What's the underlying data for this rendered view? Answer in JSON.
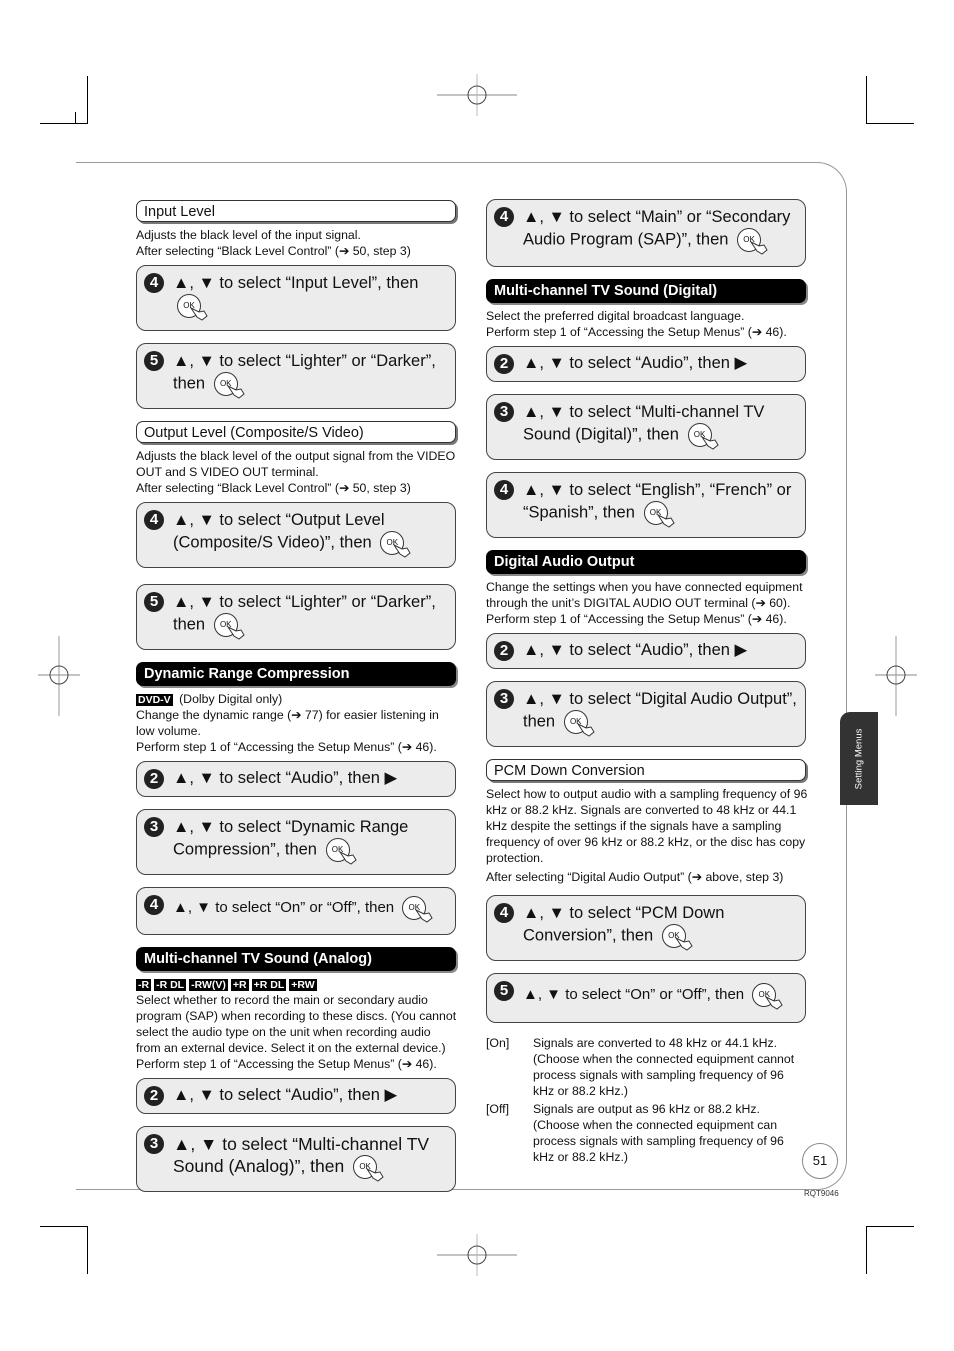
{
  "left_column": {
    "input_level": {
      "title": "Input Level",
      "desc": [
        "Adjusts the black level of the input signal.",
        "After selecting “Black Level Control” (➔ 50, step 3)"
      ],
      "steps": [
        {
          "num": "4",
          "text": "▲, ▼ to select “Input Level”, then"
        },
        {
          "num": "5",
          "text": "▲, ▼ to select “Lighter” or “Darker”, then"
        }
      ]
    },
    "output_level": {
      "title": "Output Level (Composite/S Video)",
      "desc": [
        "Adjusts the black level of the output signal from the VIDEO OUT and S VIDEO OUT terminal.",
        "After selecting “Black Level Control” (➔ 50, step 3)"
      ],
      "steps": [
        {
          "num": "4",
          "text": "▲, ▼ to select “Output Level (Composite/S Video)”, then"
        },
        {
          "num": "5",
          "text": "▲, ▼ to select “Lighter” or “Darker”, then"
        }
      ]
    },
    "drc": {
      "title": "Dynamic Range Compression",
      "badge": "DVD-V",
      "badge_note": " (Dolby Digital only)",
      "desc": [
        "Change the dynamic range (➔ 77) for easier listening in low volume.",
        "Perform step 1 of “Accessing the Setup Menus” (➔ 46)."
      ],
      "steps": [
        {
          "num": "2",
          "text": "▲, ▼ to select “Audio”, then ▶"
        },
        {
          "num": "3",
          "text": "▲, ▼ to select “Dynamic Range Compression”, then"
        },
        {
          "num": "4",
          "text": "▲, ▼ to select “On” or “Off”, then"
        }
      ]
    },
    "mts_analog": {
      "title": "Multi-channel TV Sound (Analog)",
      "badges": [
        "-R",
        "-R DL",
        "-RW(V)",
        "+R",
        "+R DL",
        "+RW"
      ],
      "desc": [
        "Select whether to record the main or secondary audio program (SAP) when recording to these discs. (You cannot select the audio type on the unit when recording audio from an external device. Select it on the external device.)",
        "Perform step 1 of “Accessing the Setup Menus” (➔ 46)."
      ],
      "steps": [
        {
          "num": "2",
          "text": "▲, ▼ to select “Audio”, then ▶"
        },
        {
          "num": "3",
          "text": "▲, ▼ to select “Multi-channel TV Sound (Analog)”, then"
        }
      ]
    }
  },
  "right_column": {
    "mts_analog_cont": {
      "steps": [
        {
          "num": "4",
          "text": "▲, ▼ to select “Main” or “Secondary Audio Program (SAP)”, then"
        }
      ]
    },
    "mts_digital": {
      "title": "Multi-channel TV Sound (Digital)",
      "desc": [
        "Select the preferred digital broadcast language.",
        "Perform step 1 of “Accessing the Setup Menus” (➔ 46)."
      ],
      "steps": [
        {
          "num": "2",
          "text": "▲, ▼ to select “Audio”, then ▶"
        },
        {
          "num": "3",
          "text": "▲, ▼ to select “Multi-channel TV Sound (Digital)”, then"
        },
        {
          "num": "4",
          "text": "▲, ▼ to select “English”, “French” or “Spanish”, then"
        }
      ]
    },
    "digital_audio_output": {
      "title": "Digital Audio Output",
      "desc": [
        "Change the settings when you have connected equipment through the unit’s DIGITAL AUDIO OUT terminal (➔ 60).",
        "Perform step 1 of “Accessing the Setup Menus” (➔ 46)."
      ],
      "steps": [
        {
          "num": "2",
          "text": "▲, ▼ to select “Audio”, then ▶"
        },
        {
          "num": "3",
          "text": "▲, ▼ to select “Digital Audio Output”, then"
        }
      ]
    },
    "pcm": {
      "title": "PCM Down Conversion",
      "desc": [
        "Select how to output audio with a sampling frequency of 96 kHz or 88.2 kHz. Signals are converted to 48 kHz or 44.1 kHz despite the settings if the signals have a sampling frequency of over 96 kHz or 88.2 kHz, or the disc has copy protection.",
        "After selecting “Digital Audio Output” (➔ above, step 3)"
      ],
      "steps": [
        {
          "num": "4",
          "text": "▲, ▼ to select “PCM Down Conversion”, then"
        },
        {
          "num": "5",
          "text": "▲, ▼ to select “On” or “Off”, then"
        }
      ],
      "options": [
        {
          "key": "[On]",
          "text": "Signals are converted to 48 kHz or 44.1 kHz. (Choose when the connected equipment cannot process signals with sampling frequency of 96 kHz or 88.2 kHz.)"
        },
        {
          "key": "[Off]",
          "text": "Signals are output as 96 kHz or 88.2 kHz. (Choose when the connected equipment can process signals with sampling frequency of 96 kHz or 88.2 kHz.)"
        }
      ]
    }
  },
  "ok_label": "OK",
  "side_tab": "Setting Menus",
  "page_number": "51",
  "doc_code": "RQT9046"
}
